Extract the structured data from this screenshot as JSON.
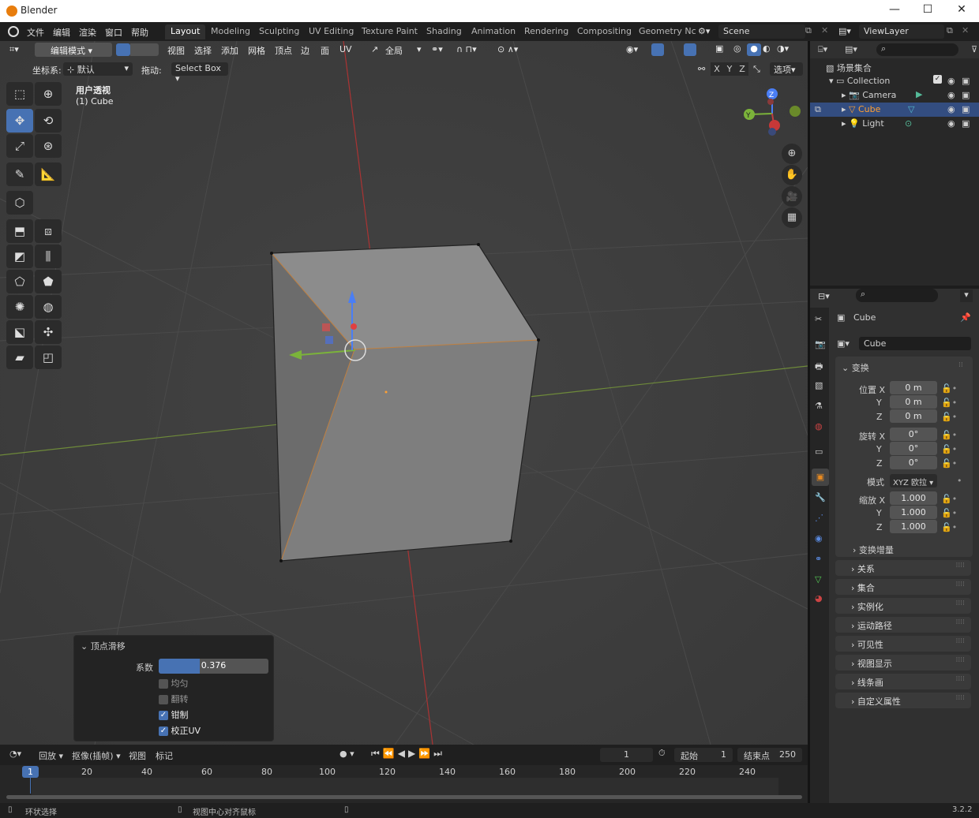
{
  "window": {
    "title": "Blender"
  },
  "topbar": {
    "menus": [
      "文件",
      "编辑",
      "渲染",
      "窗口",
      "帮助"
    ],
    "workspaces": [
      "Layout",
      "Modeling",
      "Sculpting",
      "UV Editing",
      "Texture Paint",
      "Shading",
      "Animation",
      "Rendering",
      "Compositing",
      "Geometry Nc"
    ],
    "active_workspace": "Layout",
    "scene": "Scene",
    "view_layer": "ViewLayer"
  },
  "viewport_header": {
    "mode": "编辑模式",
    "menus": [
      "视图",
      "选择",
      "添加",
      "网格",
      "顶点",
      "边",
      "面",
      "UV"
    ],
    "transform_orientation": "全局",
    "coord_label": "坐标系:",
    "coord_value": "默认",
    "drag_label": "拖动:",
    "drag_value": "Select Box",
    "axis_labels": [
      "X",
      "Y",
      "Z"
    ],
    "options_label": "选项"
  },
  "viewport": {
    "view_name": "用户透视",
    "object_info": "(1) Cube",
    "gizmo_axes": {
      "x": "X",
      "y": "Y",
      "z": "Z"
    }
  },
  "redo_panel": {
    "title": "顶点滑移",
    "factor_label": "系数",
    "factor_value": "0.376",
    "factor_fraction": 0.376,
    "options": [
      {
        "label": "均匀",
        "checked": false
      },
      {
        "label": "翻转",
        "checked": false
      },
      {
        "label": "钳制",
        "checked": true
      },
      {
        "label": "校正UV",
        "checked": true
      }
    ]
  },
  "timeline": {
    "menus": [
      "回放",
      "抠像(插帧)",
      "视图",
      "标记"
    ],
    "current_frame": "1",
    "start_label": "起始",
    "start_value": "1",
    "end_label": "结束点",
    "end_value": "250",
    "ticks": [
      "20",
      "40",
      "60",
      "80",
      "100",
      "120",
      "140",
      "160",
      "180",
      "200",
      "220",
      "240"
    ],
    "playhead": "1"
  },
  "statusbar": {
    "left": "环状选择",
    "middle": "视图中心对齐鼠标",
    "version": "3.2.2"
  },
  "outliner": {
    "root": "场景集合",
    "collection": "Collection",
    "items": [
      {
        "name": "Camera"
      },
      {
        "name": "Cube"
      },
      {
        "name": "Light"
      }
    ]
  },
  "properties": {
    "object_name": "Cube",
    "datablock": "Cube",
    "transform_title": "变换",
    "location_label": "位置 X",
    "location": [
      "0 m",
      "0 m",
      "0 m"
    ],
    "rotation_label": "旋转 X",
    "rotation": [
      "0°",
      "0°",
      "0°"
    ],
    "mode_label": "模式",
    "mode_value": "XYZ 欧拉",
    "scale_label": "缩放 X",
    "scale": [
      "1.000",
      "1.000",
      "1.000"
    ],
    "axis_y": "Y",
    "axis_z": "Z",
    "delta_transform": "变换增量",
    "sections": [
      "关系",
      "集合",
      "实例化",
      "运动路径",
      "可见性",
      "视图显示",
      "线条画",
      "自定义属性"
    ]
  },
  "colors": {
    "accent": "#4772b3",
    "viewport_bg": "#3d3d3d",
    "selected_orange": "#ffa033"
  }
}
